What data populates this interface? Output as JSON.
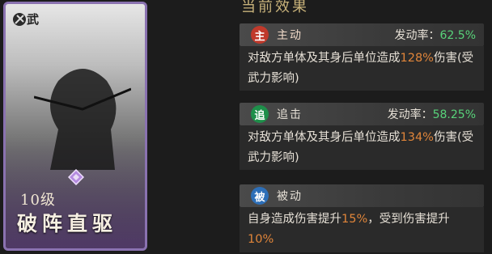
{
  "card": {
    "tag": "武",
    "level": "10级",
    "name": "破阵直驱"
  },
  "panel": {
    "title": "当前效果",
    "effects": [
      {
        "badge": "主",
        "badge_color": "#c0392b",
        "type": "主动",
        "rate_label": "发动率：",
        "rate_value": "62.5%",
        "desc_a": "对敌方单体及其身后单位造成",
        "desc_hl": "128%",
        "desc_b": "伤害(受武力影响)"
      },
      {
        "badge": "追",
        "badge_color": "#1e8f4a",
        "type": "追击",
        "rate_label": "发动率：",
        "rate_value": "58.25%",
        "desc_a": "对敌方单体及其身后单位造成",
        "desc_hl": "134%",
        "desc_b": "伤害(受武力影响)"
      },
      {
        "badge": "被",
        "badge_color": "#2d6fb8",
        "type": "被动",
        "desc_a": "自身造成伤害提升",
        "desc_hl": "15%",
        "desc_b": "，受到伤害提升",
        "desc_hl2": "10%"
      }
    ]
  }
}
